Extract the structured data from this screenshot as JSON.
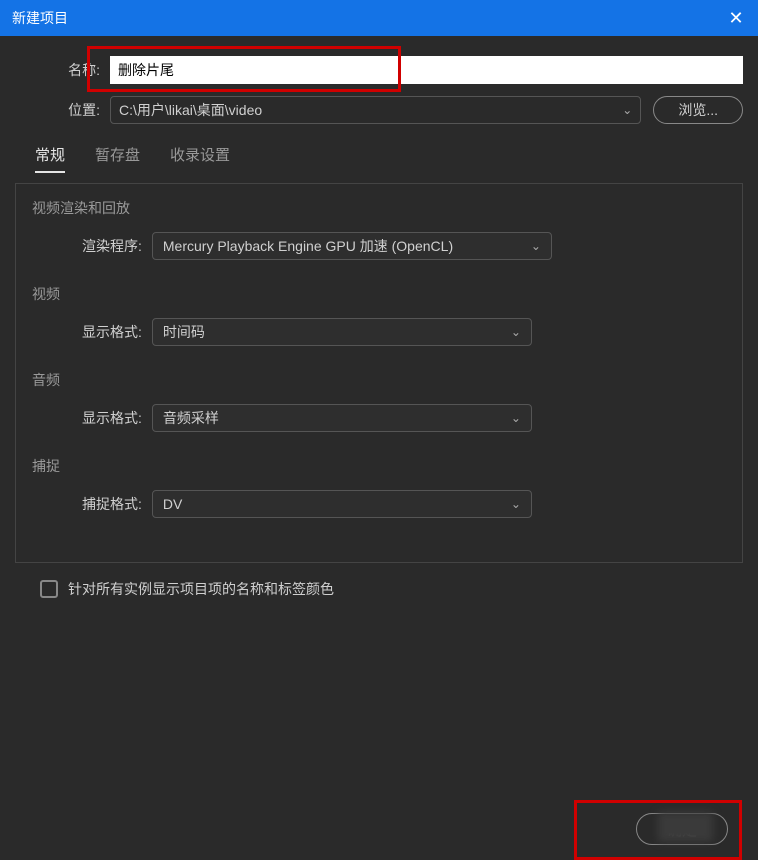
{
  "window": {
    "title": "新建项目"
  },
  "form": {
    "name_label": "名称:",
    "name_value": "删除片尾",
    "location_label": "位置:",
    "location_value": "C:\\用户\\likai\\桌面\\video",
    "browse_label": "浏览..."
  },
  "tabs": {
    "general": "常规",
    "scratch": "暂存盘",
    "ingest": "收录设置"
  },
  "sections": {
    "render": {
      "title": "视频渲染和回放",
      "label": "渲染程序:",
      "value": "Mercury Playback Engine GPU 加速 (OpenCL)"
    },
    "video": {
      "title": "视频",
      "label": "显示格式:",
      "value": "时间码"
    },
    "audio": {
      "title": "音频",
      "label": "显示格式:",
      "value": "音频采样"
    },
    "capture": {
      "title": "捕捉",
      "label": "捕捉格式:",
      "value": "DV"
    }
  },
  "checkbox": {
    "label": "针对所有实例显示项目项的名称和标签颜色"
  },
  "footer": {
    "ok_label": "确定"
  }
}
